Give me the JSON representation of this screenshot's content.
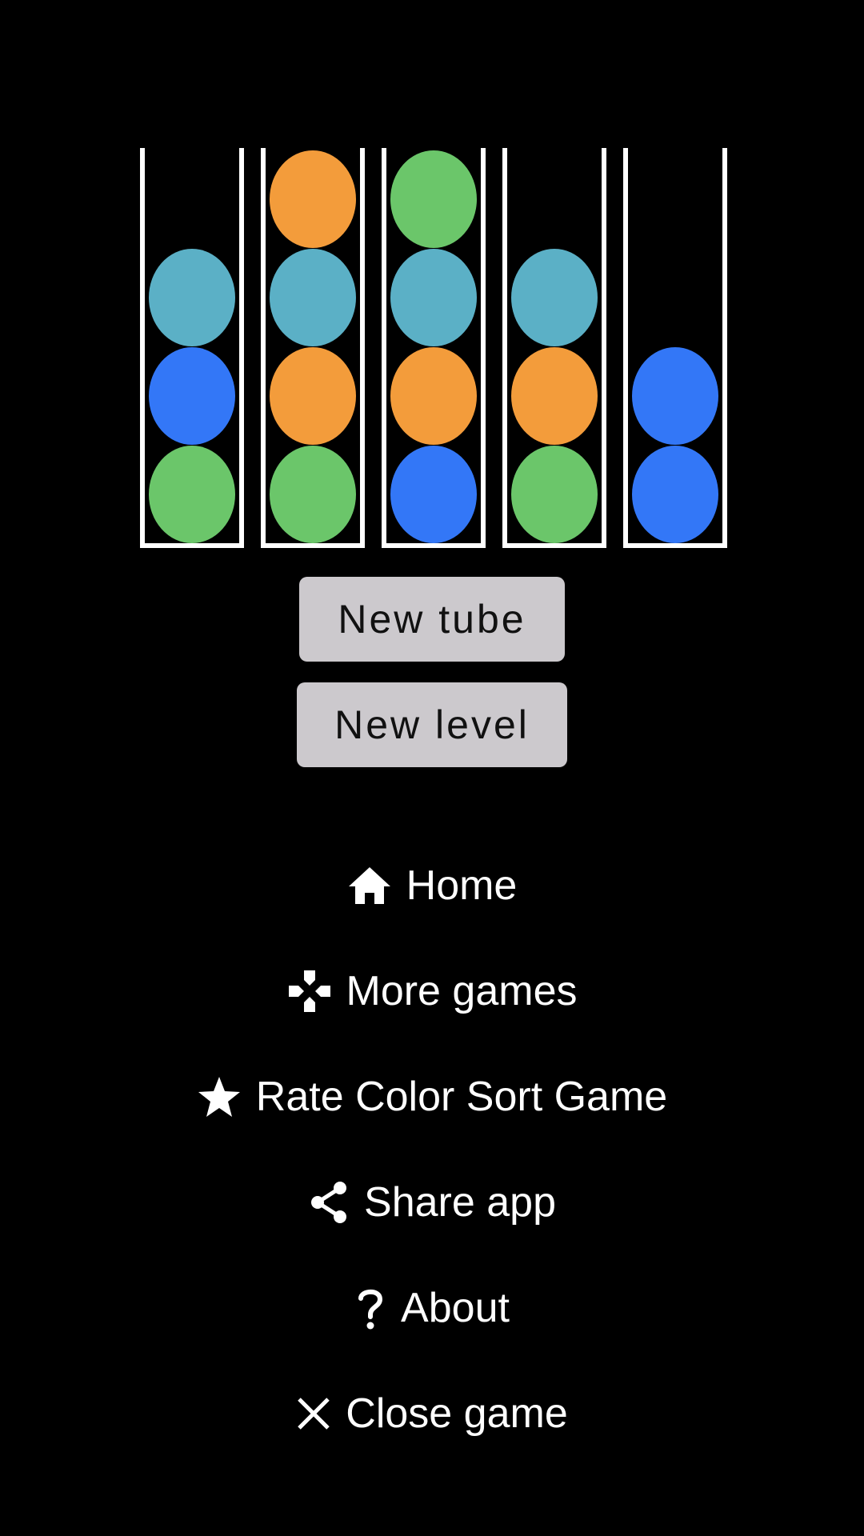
{
  "colors": {
    "background": "#000000",
    "tube_border": "#ffffff",
    "teal": "#5bb0c6",
    "blue": "#3377f7",
    "green": "#6bc66a",
    "orange": "#f39c3b",
    "button_bg": "#ccc9cd"
  },
  "tubes": [
    {
      "balls_top_to_bottom": [
        "teal",
        "blue",
        "green"
      ]
    },
    {
      "balls_top_to_bottom": [
        "orange",
        "teal",
        "orange",
        "green"
      ]
    },
    {
      "balls_top_to_bottom": [
        "green",
        "teal",
        "orange",
        "blue"
      ]
    },
    {
      "balls_top_to_bottom": [
        "teal",
        "orange",
        "green"
      ]
    },
    {
      "balls_top_to_bottom": [
        "blue",
        "blue"
      ]
    }
  ],
  "buttons": {
    "new_tube": "New tube",
    "new_level": "New level"
  },
  "menu": {
    "home": {
      "label": "Home",
      "icon": "home-icon"
    },
    "more_games": {
      "label": "More games",
      "icon": "gamepad-icon"
    },
    "rate": {
      "label": "Rate Color Sort Game",
      "icon": "star-icon"
    },
    "share": {
      "label": "Share app",
      "icon": "share-icon"
    },
    "about": {
      "label": "About",
      "icon": "question-icon"
    },
    "close": {
      "label": "Close game",
      "icon": "close-icon"
    }
  }
}
